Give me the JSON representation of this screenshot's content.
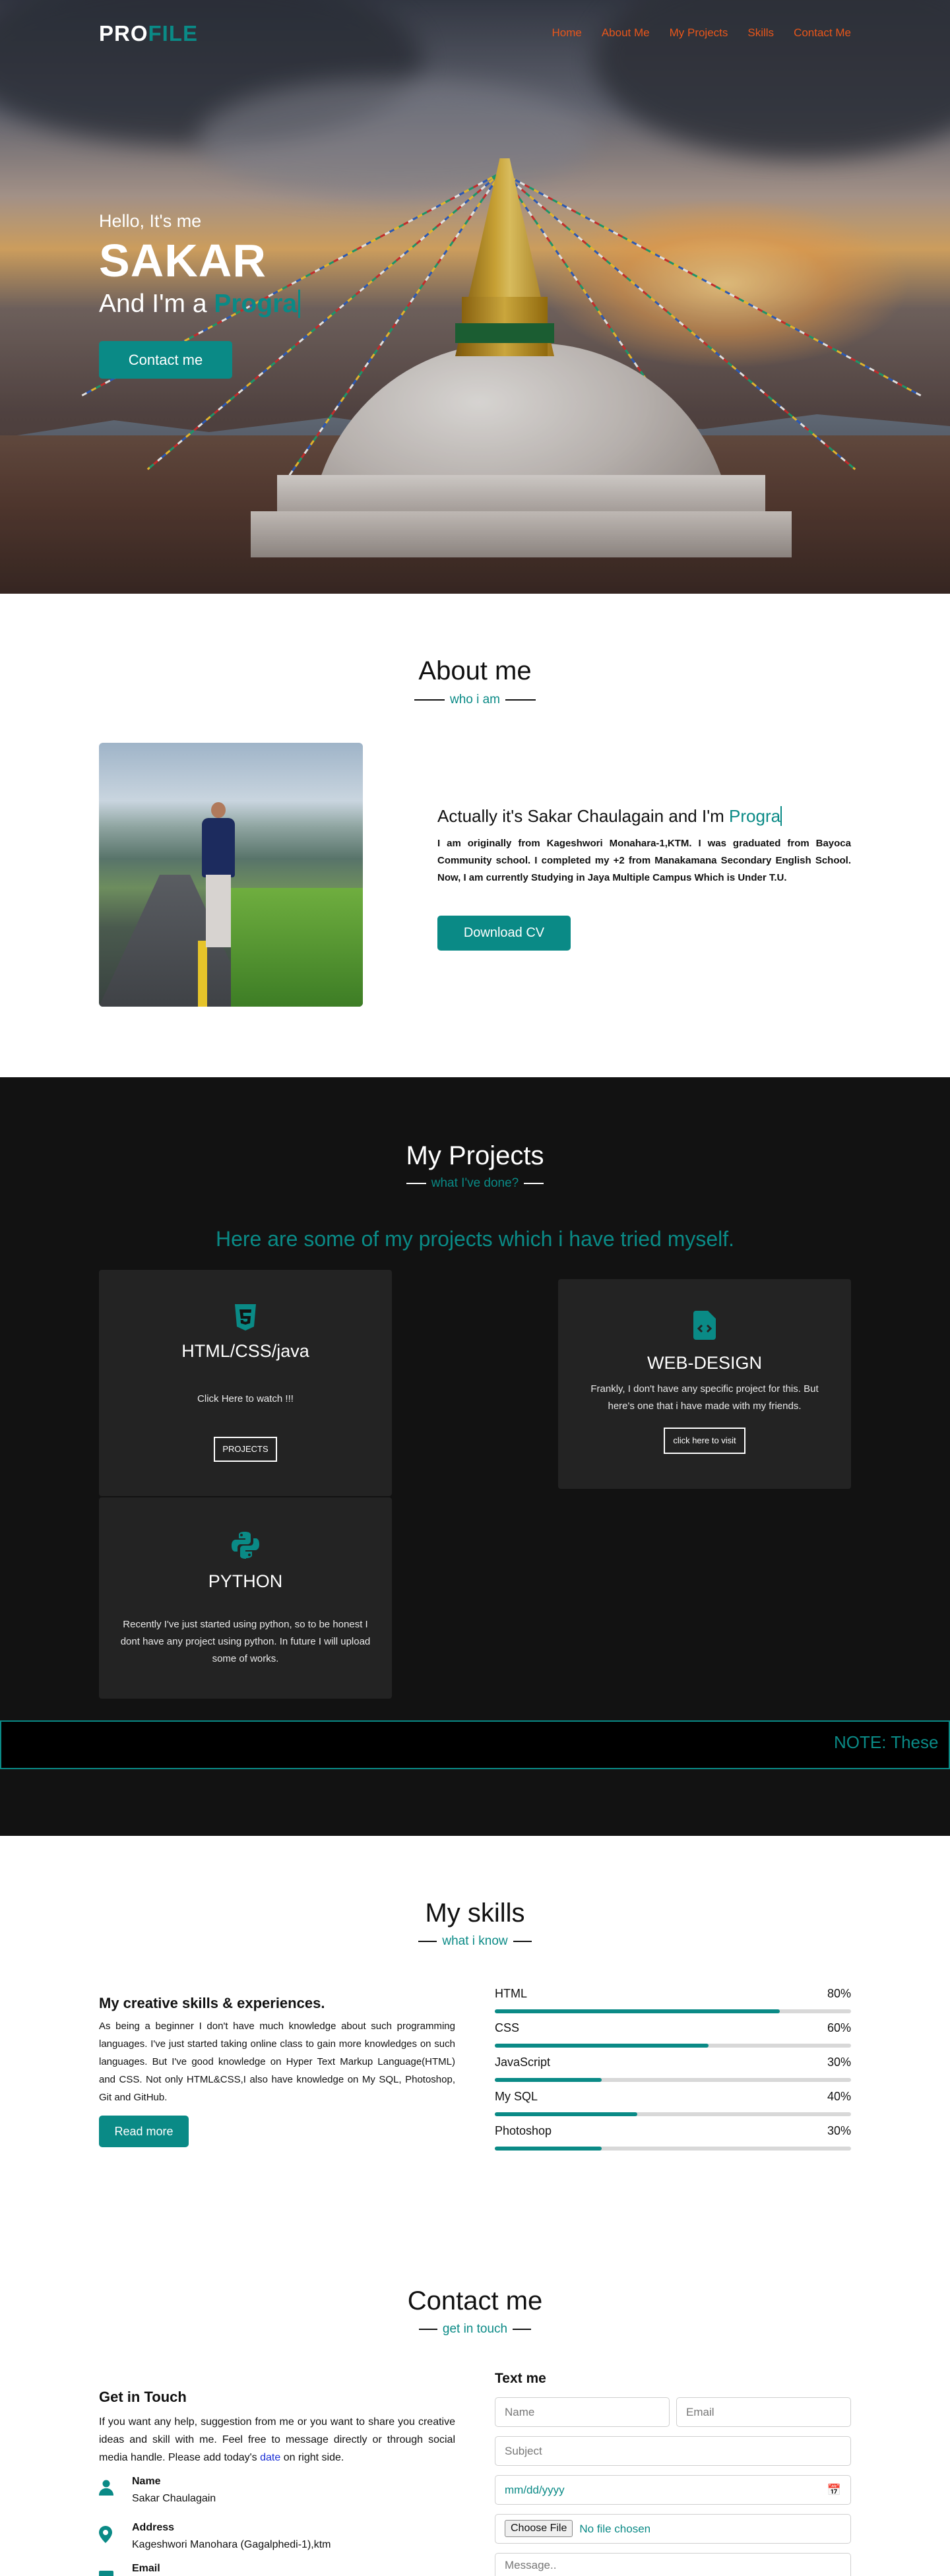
{
  "nav": {
    "logo_a": "PRO",
    "logo_b": "FILE",
    "items": [
      "Home",
      "About Me",
      "My Projects",
      "Skills",
      "Contact Me"
    ]
  },
  "hero": {
    "hello": "Hello, It's me",
    "name": "SAKAR",
    "role_prefix": "And I'm a ",
    "role_typed": "Progra",
    "button": "Contact me"
  },
  "about": {
    "title": "About me",
    "subtitle": "who i am",
    "heading_prefix": "Actually it's Sakar Chaulagain and I'm ",
    "heading_typed": "Progra",
    "paragraph": "I am originally from Kageshwori Monahara-1,KTM. I was graduated from Bayoca Community school. I completed my +2 from Manakamana Secondary English School. Now, I am currently Studying in Jaya Multiple Campus Which is Under T.U.",
    "button": "Download CV"
  },
  "projects": {
    "title": "My Projects",
    "subtitle": "what I've done?",
    "lead": "Here are some of my projects which i have tried myself.",
    "cards": [
      {
        "icon": "html5-icon",
        "title": "HTML/CSS/java",
        "text": "Click Here to watch !!!",
        "button": "PROJECTS"
      },
      {
        "icon": "file-code-icon",
        "title": "WEB-DESIGN",
        "text": "Frankly, I don't have any specific project for this. But here's one that i have made with my friends.",
        "button": "click here to visit"
      },
      {
        "icon": "python-icon",
        "title": "PYTHON",
        "text": "Recently I've just started using python, so to be honest I dont have any project using python. In future I will upload some of works."
      }
    ],
    "marquee": "NOTE:  These"
  },
  "skills": {
    "title": "My skills",
    "subtitle": "what i know",
    "heading": "My creative skills & experiences.",
    "paragraph": "As being a beginner I don't have much knowledge about such programming languages. I've just started taking online class to gain more knowledges on such languages. But I've good knowledge on Hyper Text Markup Language(HTML) and CSS. Not only HTML&CSS,I also have knowledge on My SQL, Photoshop, Git and GitHub.",
    "button": "Read more",
    "bars": [
      {
        "name": "HTML",
        "percent": "80%",
        "value": 0.8
      },
      {
        "name": "CSS",
        "percent": "60%",
        "value": 0.6
      },
      {
        "name": "JavaScript",
        "percent": "30%",
        "value": 0.3
      },
      {
        "name": "My SQL",
        "percent": "40%",
        "value": 0.4
      },
      {
        "name": "Photoshop",
        "percent": "30%",
        "value": 0.3
      }
    ]
  },
  "contact": {
    "title": "Contact me",
    "subtitle": "get in touch",
    "heading": "Get in Touch",
    "paragraph_a": "If you want any help, suggestion from me or you want to share you creative ideas and skill with me. Feel free to message directly or through social media handle. Please add today's ",
    "paragraph_hl": "date",
    "paragraph_b": " on right side.",
    "items": [
      {
        "label": "Name",
        "value": "Sakar Chaulagain"
      },
      {
        "label": "Address",
        "value": "Kageshwori Manohara (Gagalphedi-1),ktm"
      },
      {
        "label": "Email"
      }
    ],
    "form": {
      "heading": "Text me",
      "name_placeholder": "Name",
      "email_placeholder": "Email",
      "subject_placeholder": "Subject",
      "date_placeholder": "mm/dd/yyyy",
      "file_button": "Choose File",
      "file_status": "No file chosen",
      "message_placeholder": "Message.."
    }
  },
  "colors": {
    "accent": "#0a8a86",
    "nav": "#e9561a",
    "dark": "#121212",
    "card": "#232323"
  }
}
